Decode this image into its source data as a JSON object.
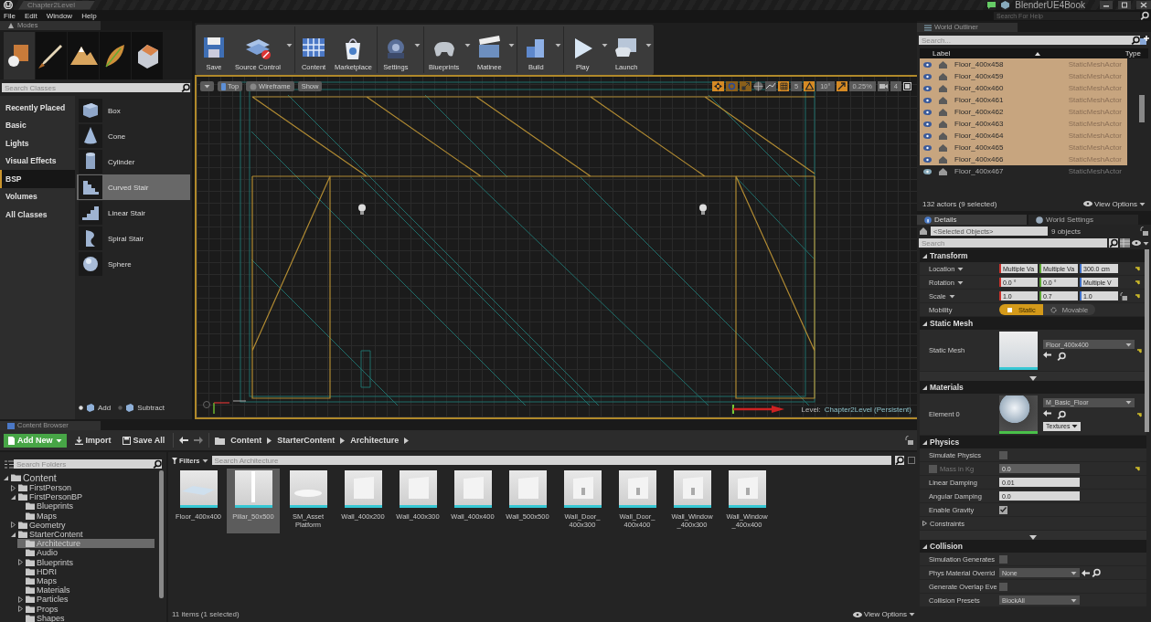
{
  "title_bar": {
    "tab": "Chapter2Level",
    "project": "BlenderUE4Book"
  },
  "menu": [
    "File",
    "Edit",
    "Window",
    "Help"
  ],
  "help_search": {
    "placeholder": "Search For Help"
  },
  "modes": {
    "tab": "Modes",
    "mode_tabs": [
      {
        "selected": true
      },
      {
        "selected": false
      },
      {
        "selected": false
      },
      {
        "selected": false
      },
      {
        "selected": false
      }
    ],
    "search": {
      "placeholder": "Search Classes"
    },
    "categories": [
      {
        "label": "Recently Placed",
        "selected": false
      },
      {
        "label": "Basic",
        "selected": false
      },
      {
        "label": "Lights",
        "selected": false
      },
      {
        "label": "Visual Effects",
        "selected": false
      },
      {
        "label": "BSP",
        "selected": true
      },
      {
        "label": "Volumes",
        "selected": false
      },
      {
        "label": "All Classes",
        "selected": false
      }
    ],
    "items": [
      {
        "label": "Box",
        "selected": false
      },
      {
        "label": "Cone",
        "selected": false
      },
      {
        "label": "Cylinder",
        "selected": false
      },
      {
        "label": "Curved Stair",
        "selected": true
      },
      {
        "label": "Linear Stair",
        "selected": false
      },
      {
        "label": "Spiral Stair",
        "selected": false
      },
      {
        "label": "Sphere",
        "selected": false
      }
    ],
    "brush_types": [
      {
        "label": "Add",
        "selected": true
      },
      {
        "label": "Subtract",
        "selected": false
      }
    ]
  },
  "toolbar": [
    {
      "label": "Save",
      "dropdown": false
    },
    {
      "label": "Source Control",
      "dropdown": true
    },
    {
      "label": "Content",
      "dropdown": false
    },
    {
      "label": "Marketplace",
      "dropdown": false
    },
    {
      "label": "Settings",
      "dropdown": true
    },
    {
      "label": "Blueprints",
      "dropdown": true
    },
    {
      "label": "Matinee",
      "dropdown": true
    },
    {
      "label": "Build",
      "dropdown": true
    },
    {
      "label": "Play",
      "dropdown": true
    },
    {
      "label": "Launch",
      "dropdown": true
    }
  ],
  "viewport": {
    "view": "Top",
    "mode": "Wireframe",
    "show": "Show",
    "transform_tools": [
      {
        "selected": true
      },
      {
        "selected": false
      },
      {
        "selected": false
      }
    ],
    "snaps": [
      {
        "value": "5",
        "on": true
      },
      {
        "value": "10°",
        "on": true
      },
      {
        "value": "0.25%",
        "on": true
      }
    ],
    "camera_speed": "4",
    "level_label": "Level:",
    "level_name": "Chapter2Level (Persistent)"
  },
  "world_outliner": {
    "tab": "World Outliner",
    "search": {
      "placeholder": "Search..."
    },
    "columns": [
      "Label",
      "Type"
    ],
    "rows": [
      {
        "label": "Floor_400x458",
        "type": "StaticMeshActor",
        "selected": true
      },
      {
        "label": "Floor_400x459",
        "type": "StaticMeshActor",
        "selected": true
      },
      {
        "label": "Floor_400x460",
        "type": "StaticMeshActor",
        "selected": true
      },
      {
        "label": "Floor_400x461",
        "type": "StaticMeshActor",
        "selected": true
      },
      {
        "label": "Floor_400x462",
        "type": "StaticMeshActor",
        "selected": true
      },
      {
        "label": "Floor_400x463",
        "type": "StaticMeshActor",
        "selected": true
      },
      {
        "label": "Floor_400x464",
        "type": "StaticMeshActor",
        "selected": true
      },
      {
        "label": "Floor_400x465",
        "type": "StaticMeshActor",
        "selected": true
      },
      {
        "label": "Floor_400x466",
        "type": "StaticMeshActor",
        "selected": true
      },
      {
        "label": "Floor_400x467",
        "type": "StaticMeshActor",
        "selected": false
      }
    ],
    "status": "132 actors (9 selected)",
    "view_options": "View Options"
  },
  "details": {
    "tabs": [
      {
        "label": "Details",
        "selected": true
      },
      {
        "label": "World Settings",
        "selected": false
      }
    ],
    "selection": {
      "placeholder": "<Selected Objects>"
    },
    "count": "9 objects",
    "search": {
      "placeholder": "Search"
    },
    "sections": [
      {
        "title": "Transform",
        "advanced": false,
        "rows": [
          {
            "kind": "vector",
            "label": "Location",
            "values": [
              "Multiple Va",
              "Multiple Va",
              "300.0 cm"
            ],
            "lock": false,
            "reset": true
          },
          {
            "kind": "vector",
            "label": "Rotation",
            "values": [
              "0.0 °",
              "0.0 °",
              "Multiple V"
            ],
            "lock": false,
            "reset": true
          },
          {
            "kind": "vector",
            "label": "Scale",
            "values": [
              "1.0",
              "0.7",
              "1.0"
            ],
            "lock": true,
            "reset": true
          },
          {
            "kind": "toggle",
            "label": "Mobility",
            "options": [
              {
                "label": "Static",
                "selected": true
              },
              {
                "label": "Movable",
                "selected": false
              }
            ],
            "reset": false
          }
        ]
      },
      {
        "title": "Static Mesh",
        "advanced": true,
        "rows": [
          {
            "kind": "mesh_asset",
            "label": "Static Mesh",
            "value": "Floor_400x400",
            "reset": true
          }
        ]
      },
      {
        "title": "Materials",
        "advanced": false,
        "rows": [
          {
            "kind": "material_asset",
            "label": "Element 0",
            "value": "M_Basic_Floor",
            "button": "Textures",
            "reset": true
          }
        ]
      },
      {
        "title": "Physics",
        "advanced": true,
        "rows": [
          {
            "kind": "checkbox",
            "label": "Simulate Physics",
            "checked": false,
            "reset": false
          },
          {
            "kind": "optional_number",
            "label": "Mass in Kg",
            "checked": false,
            "disabled": true,
            "value": "0.0",
            "reset": true
          },
          {
            "kind": "number",
            "label": "Linear Damping",
            "value": "0.01",
            "reset": false
          },
          {
            "kind": "number",
            "label": "Angular Damping",
            "value": "0.0",
            "reset": false
          },
          {
            "kind": "checkbox",
            "label": "Enable Gravity",
            "checked": true,
            "reset": false
          },
          {
            "kind": "group",
            "label": "Constraints",
            "expanded": false
          }
        ]
      },
      {
        "title": "Collision",
        "advanced": false,
        "rows": [
          {
            "kind": "checkbox",
            "label": "Simulation Generates",
            "checked": false,
            "reset": false
          },
          {
            "kind": "dropdown",
            "label": "Phys Material Overrid",
            "value": "None",
            "reset": false
          },
          {
            "kind": "checkbox",
            "label": "Generate Overlap Eve",
            "checked": false,
            "reset": false
          },
          {
            "kind": "dropdown",
            "label": "Collision Presets",
            "value": "BlockAll",
            "reset": false
          }
        ]
      }
    ]
  },
  "content_browser": {
    "tab": "Content Browser",
    "add_new": "Add New",
    "import": "Import",
    "save_all": "Save All",
    "path": [
      "Content",
      "StarterContent",
      "Architecture"
    ],
    "folder_search": {
      "placeholder": "Search Folders"
    },
    "tree": [
      {
        "label": "Content",
        "expanded": true,
        "selected": false,
        "children": [
          {
            "label": "FirstPerson",
            "expanded": false,
            "selected": false
          },
          {
            "label": "FirstPersonBP",
            "expanded": true,
            "selected": false,
            "children": [
              {
                "label": "Blueprints",
                "selected": false
              },
              {
                "label": "Maps",
                "selected": false
              }
            ]
          },
          {
            "label": "Geometry",
            "expanded": false,
            "selected": false
          },
          {
            "label": "StarterContent",
            "expanded": true,
            "selected": false,
            "children": [
              {
                "label": "Architecture",
                "selected": true
              },
              {
                "label": "Audio",
                "selected": false
              },
              {
                "label": "Blueprints",
                "expanded": false,
                "selected": false
              },
              {
                "label": "HDRI",
                "selected": false
              },
              {
                "label": "Maps",
                "selected": false
              },
              {
                "label": "Materials",
                "selected": false
              },
              {
                "label": "Particles",
                "expanded": false,
                "selected": false
              },
              {
                "label": "Props",
                "expanded": false,
                "selected": false
              },
              {
                "label": "Shapes",
                "selected": false
              }
            ]
          }
        ]
      }
    ],
    "filters": "Filters",
    "asset_search": {
      "placeholder": "Search Architecture"
    },
    "assets": [
      {
        "name": "Floor_400x400",
        "selected": false
      },
      {
        "name": "Pillar_50x500",
        "selected": true
      },
      {
        "name": "SM_Asset\nPlatform",
        "selected": false
      },
      {
        "name": "Wall_400x200",
        "selected": false
      },
      {
        "name": "Wall_400x300",
        "selected": false
      },
      {
        "name": "Wall_400x400",
        "selected": false
      },
      {
        "name": "Wall_500x500",
        "selected": false
      },
      {
        "name": "Wall_Door_\n400x300",
        "selected": false
      },
      {
        "name": "Wall_Door_\n400x400",
        "selected": false
      },
      {
        "name": "Wall_Window\n_400x300",
        "selected": false
      },
      {
        "name": "Wall_Window\n_400x400",
        "selected": false
      }
    ],
    "status": "11 items (1 selected)",
    "view_options": "View Options"
  }
}
